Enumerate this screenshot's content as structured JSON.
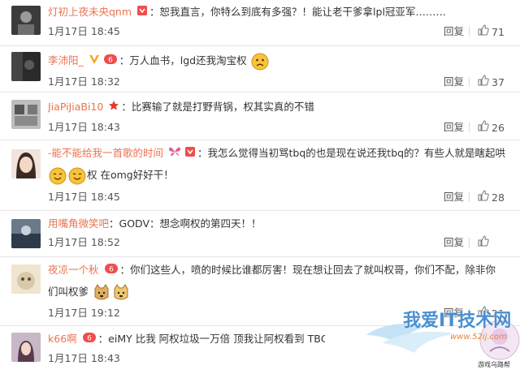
{
  "comments": [
    {
      "name": "灯初上夜未央qnm",
      "content": "恕我直言，你特么到底有多强？！能让老干爹拿lpl冠亚军………",
      "time": "1月17日 18:45",
      "reply": "回复",
      "likes": "71",
      "avatar_color": "#3b3b3b"
    },
    {
      "name": "李沛阳_",
      "content": "万人血书，lgd还我淘宝权",
      "time": "1月17日 18:32",
      "reply": "回复",
      "likes": "37",
      "avatar_color": "#2a2a2a"
    },
    {
      "name": "JiaPiJiaBi10",
      "content": "比赛输了就是打野背锅，权其实真的不错",
      "time": "1月17日 18:43",
      "reply": "回复",
      "likes": "26",
      "avatar_color": "#bdbdbd"
    },
    {
      "name": "-能不能给我一首歌的时间",
      "content": "我怎么觉得当初骂tbq的也是现在说还我tbq的？有些人就是瞎起哄",
      "content2": "权 在omg好好干！",
      "time": "1月17日 18:45",
      "reply": "回复",
      "likes": "28",
      "avatar_color": "#e7d2c6"
    },
    {
      "name": "用嘴角微笑吧",
      "content": "GODV：想念啊权的第四天！！",
      "time": "1月17日 18:52",
      "reply": "回复",
      "likes": "",
      "avatar_color": "#6a7a8a"
    },
    {
      "name": "夜凉一个秋",
      "content": "你们这些人，喷的时候比谁都厉害！现在想让回去了就叫权哥，你们不配，除非你",
      "content2": "们叫权爹",
      "time": "1月17日 19:12",
      "reply": "回复",
      "likes": "21",
      "avatar_color": "#d9c9a8"
    },
    {
      "name": "k66啊",
      "content": "eiMY 比我 阿权垃圾一万倍 顶我让阿权看到 TBQ TBQ！！",
      "time": "1月17日 18:43",
      "reply": "",
      "likes": "",
      "avatar_color": "#c7b7c7"
    }
  ],
  "watermark": {
    "title": "我爱IT技术网",
    "url": "www.52ij.com",
    "sub": "游戏乌路帮"
  },
  "colors": {
    "name": "#eb7350",
    "text": "#333333",
    "meta": "#555555",
    "border": "#e6e6e6"
  }
}
